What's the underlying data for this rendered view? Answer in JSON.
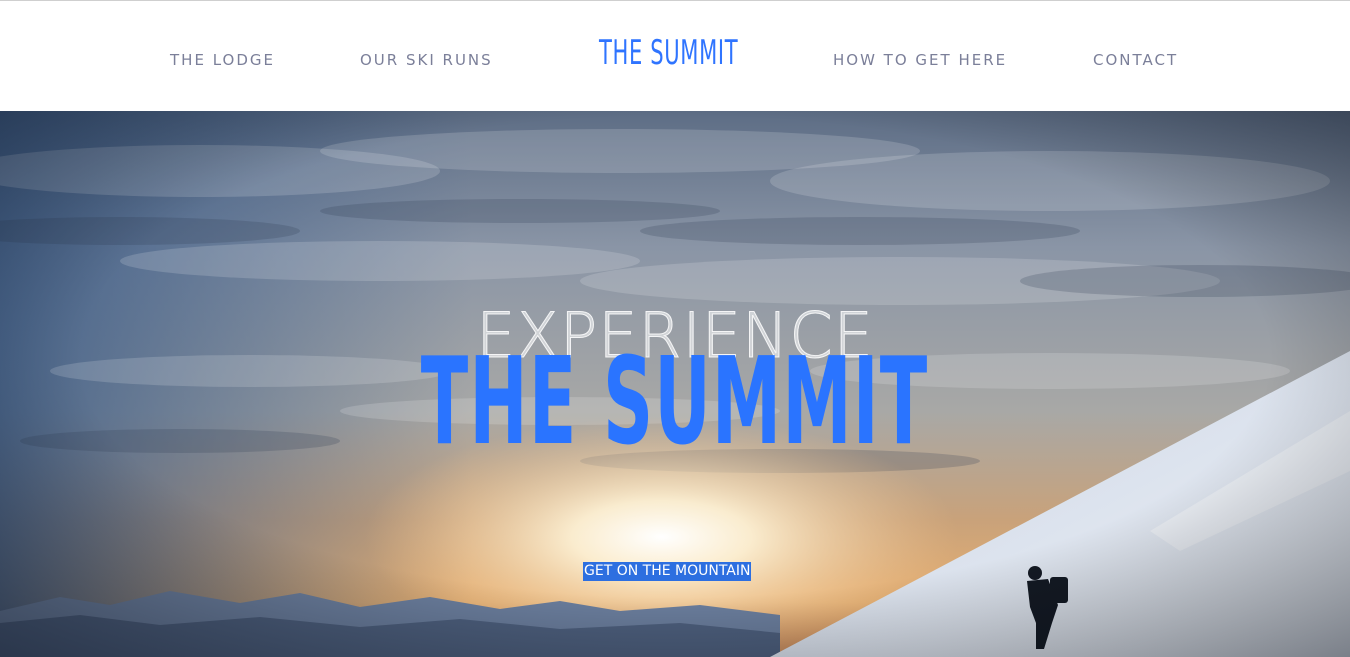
{
  "nav": {
    "left_links": [
      "THE LODGE",
      "OUR SKI RUNS"
    ],
    "brand": "THE SUMMIT",
    "right_links": [
      "HOW TO GET HERE",
      "CONTACT"
    ]
  },
  "hero": {
    "kicker": "EXPERIENCE",
    "title": "THE SUMMIT",
    "cta_label": "GET ON THE MOUNTAIN",
    "background": "mountain-sunset-photo"
  },
  "colors": {
    "brand_blue": "#2f74ff",
    "nav_text": "#7b7f99",
    "cta_background": "#2d6fe0"
  }
}
